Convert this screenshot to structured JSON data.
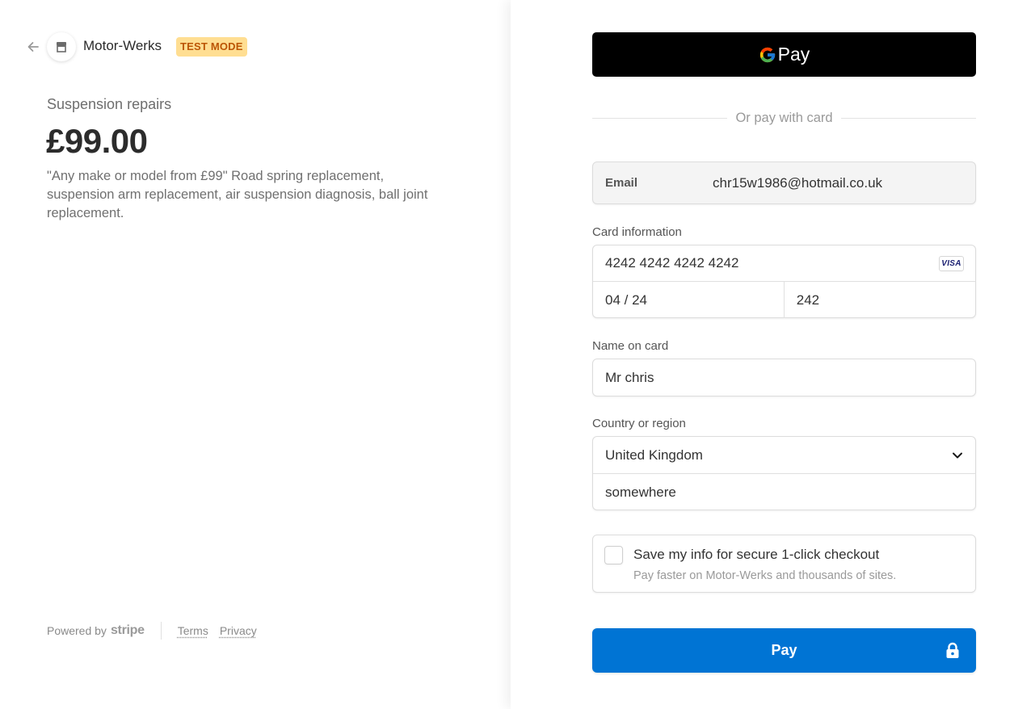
{
  "merchant": {
    "name": "Motor-Werks",
    "badge": "TEST MODE"
  },
  "product": {
    "name": "Suspension repairs",
    "price": "£99.00",
    "description": "\"Any make or model from £99\" Road spring replacement, suspension arm replacement, air suspension diagnosis, ball joint replacement."
  },
  "footer": {
    "powered_by": "Powered by",
    "brand": "stripe",
    "terms": "Terms",
    "privacy": "Privacy"
  },
  "gpay": {
    "pay_word": "Pay"
  },
  "divider_text": "Or pay with card",
  "email": {
    "label": "Email",
    "value": "chr15w1986@hotmail.co.uk"
  },
  "card": {
    "label": "Card information",
    "number": "4242 4242 4242 4242",
    "brand": "VISA",
    "expiry": "04 / 24",
    "cvc": "242"
  },
  "name_on_card": {
    "label": "Name on card",
    "value": "Mr chris"
  },
  "country": {
    "label": "Country or region",
    "selected": "United Kingdom",
    "postal": "somewhere"
  },
  "save_info": {
    "title": "Save my info for secure 1-click checkout",
    "subtitle": "Pay faster on Motor-Werks and thousands of sites.",
    "checked": false
  },
  "pay_button": {
    "label": "Pay"
  },
  "colors": {
    "accent": "#0074d4",
    "badge_bg": "#ffde92",
    "badge_text": "#bb5504"
  },
  "icons": [
    "back-arrow-icon",
    "store-icon",
    "google-g-icon",
    "visa-icon",
    "chevron-down-icon",
    "lock-icon"
  ]
}
